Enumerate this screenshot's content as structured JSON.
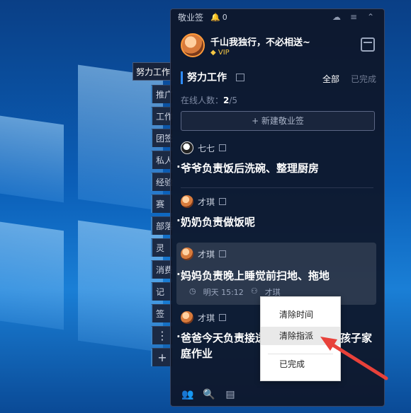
{
  "panel": {
    "title": "敬业签",
    "notif_count": "0",
    "user": {
      "name": "千山我独行，不必相送~",
      "badge": "VIP"
    },
    "section": {
      "title": "努力工作",
      "filter_all": "全部",
      "filter_done": "已完成"
    },
    "online": {
      "label": "在线人数：",
      "current": "2",
      "total": "/5"
    },
    "new_button": "+ 新建敬业签"
  },
  "tabs": {
    "main": "努力工作",
    "items": [
      "推广",
      "工作",
      "团签",
      "私人",
      "经验",
      "赛",
      "部落",
      "灵",
      "消费",
      "记",
      "签"
    ],
    "more": "⋮",
    "add": "+"
  },
  "notes": [
    {
      "author": "七七",
      "text": "爷爷负责饭后洗碗、整理厨房"
    },
    {
      "author": "才琪",
      "text": "奶奶负责做饭呢"
    },
    {
      "author": "才琪",
      "text": "妈妈负责晚上睡觉前扫地、拖地",
      "time": "明天 15:12",
      "assignee": "才琪"
    },
    {
      "author": "才琪",
      "text": "爸爸今天负责接送孩子上学和辅导孩子家庭作业"
    }
  ],
  "context_menu": {
    "items": [
      "清除时间",
      "清除指派",
      "已完成"
    ],
    "active_index": 1
  },
  "icons": {
    "bell": "bell-icon",
    "cloud": "cloud-icon",
    "menu": "menu-icon",
    "collapse": "chevron-up-icon",
    "calendar": "calendar-icon",
    "edit": "edit-icon",
    "users": "users-icon",
    "search": "search-icon",
    "notes": "notes-icon"
  },
  "colors": {
    "accent": "#2f8cff",
    "panel_bg": "#0e1628",
    "vip": "#f6c744",
    "arrow": "#e8413a"
  }
}
